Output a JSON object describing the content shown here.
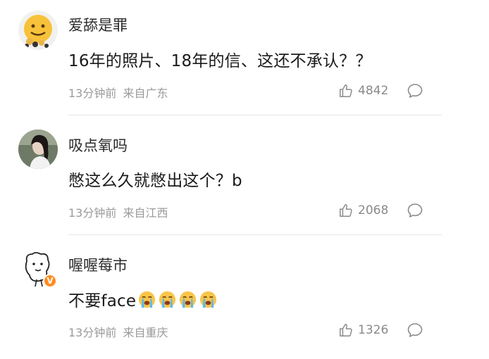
{
  "comments": [
    {
      "username": "爱舔是罪",
      "content": "16年的照片、18年的信、这还不承认？？",
      "time": "13分钟前",
      "location": "来自广东",
      "likes": "4842",
      "avatar_icon": "yellow-emoji-face-avatar"
    },
    {
      "username": "吸点氧吗",
      "content": "憋这么久就憋出这个？b",
      "time": "13分钟前",
      "location": "来自江西",
      "likes": "2068",
      "avatar_icon": "woman-photo-avatar"
    },
    {
      "username": "喔喔莓市",
      "content": "不要face",
      "time": "13分钟前",
      "location": "来自重庆",
      "likes": "1326",
      "avatar_icon": "cartoon-dog-avatar",
      "verified": true,
      "emoji_count": 4,
      "emoji_icon": "crying-face-emoji"
    }
  ],
  "colors": {
    "text": "#1a1a1a",
    "meta": "#9a9a9a",
    "divider": "#e6e6e6",
    "badge": "#ff8b1f"
  }
}
